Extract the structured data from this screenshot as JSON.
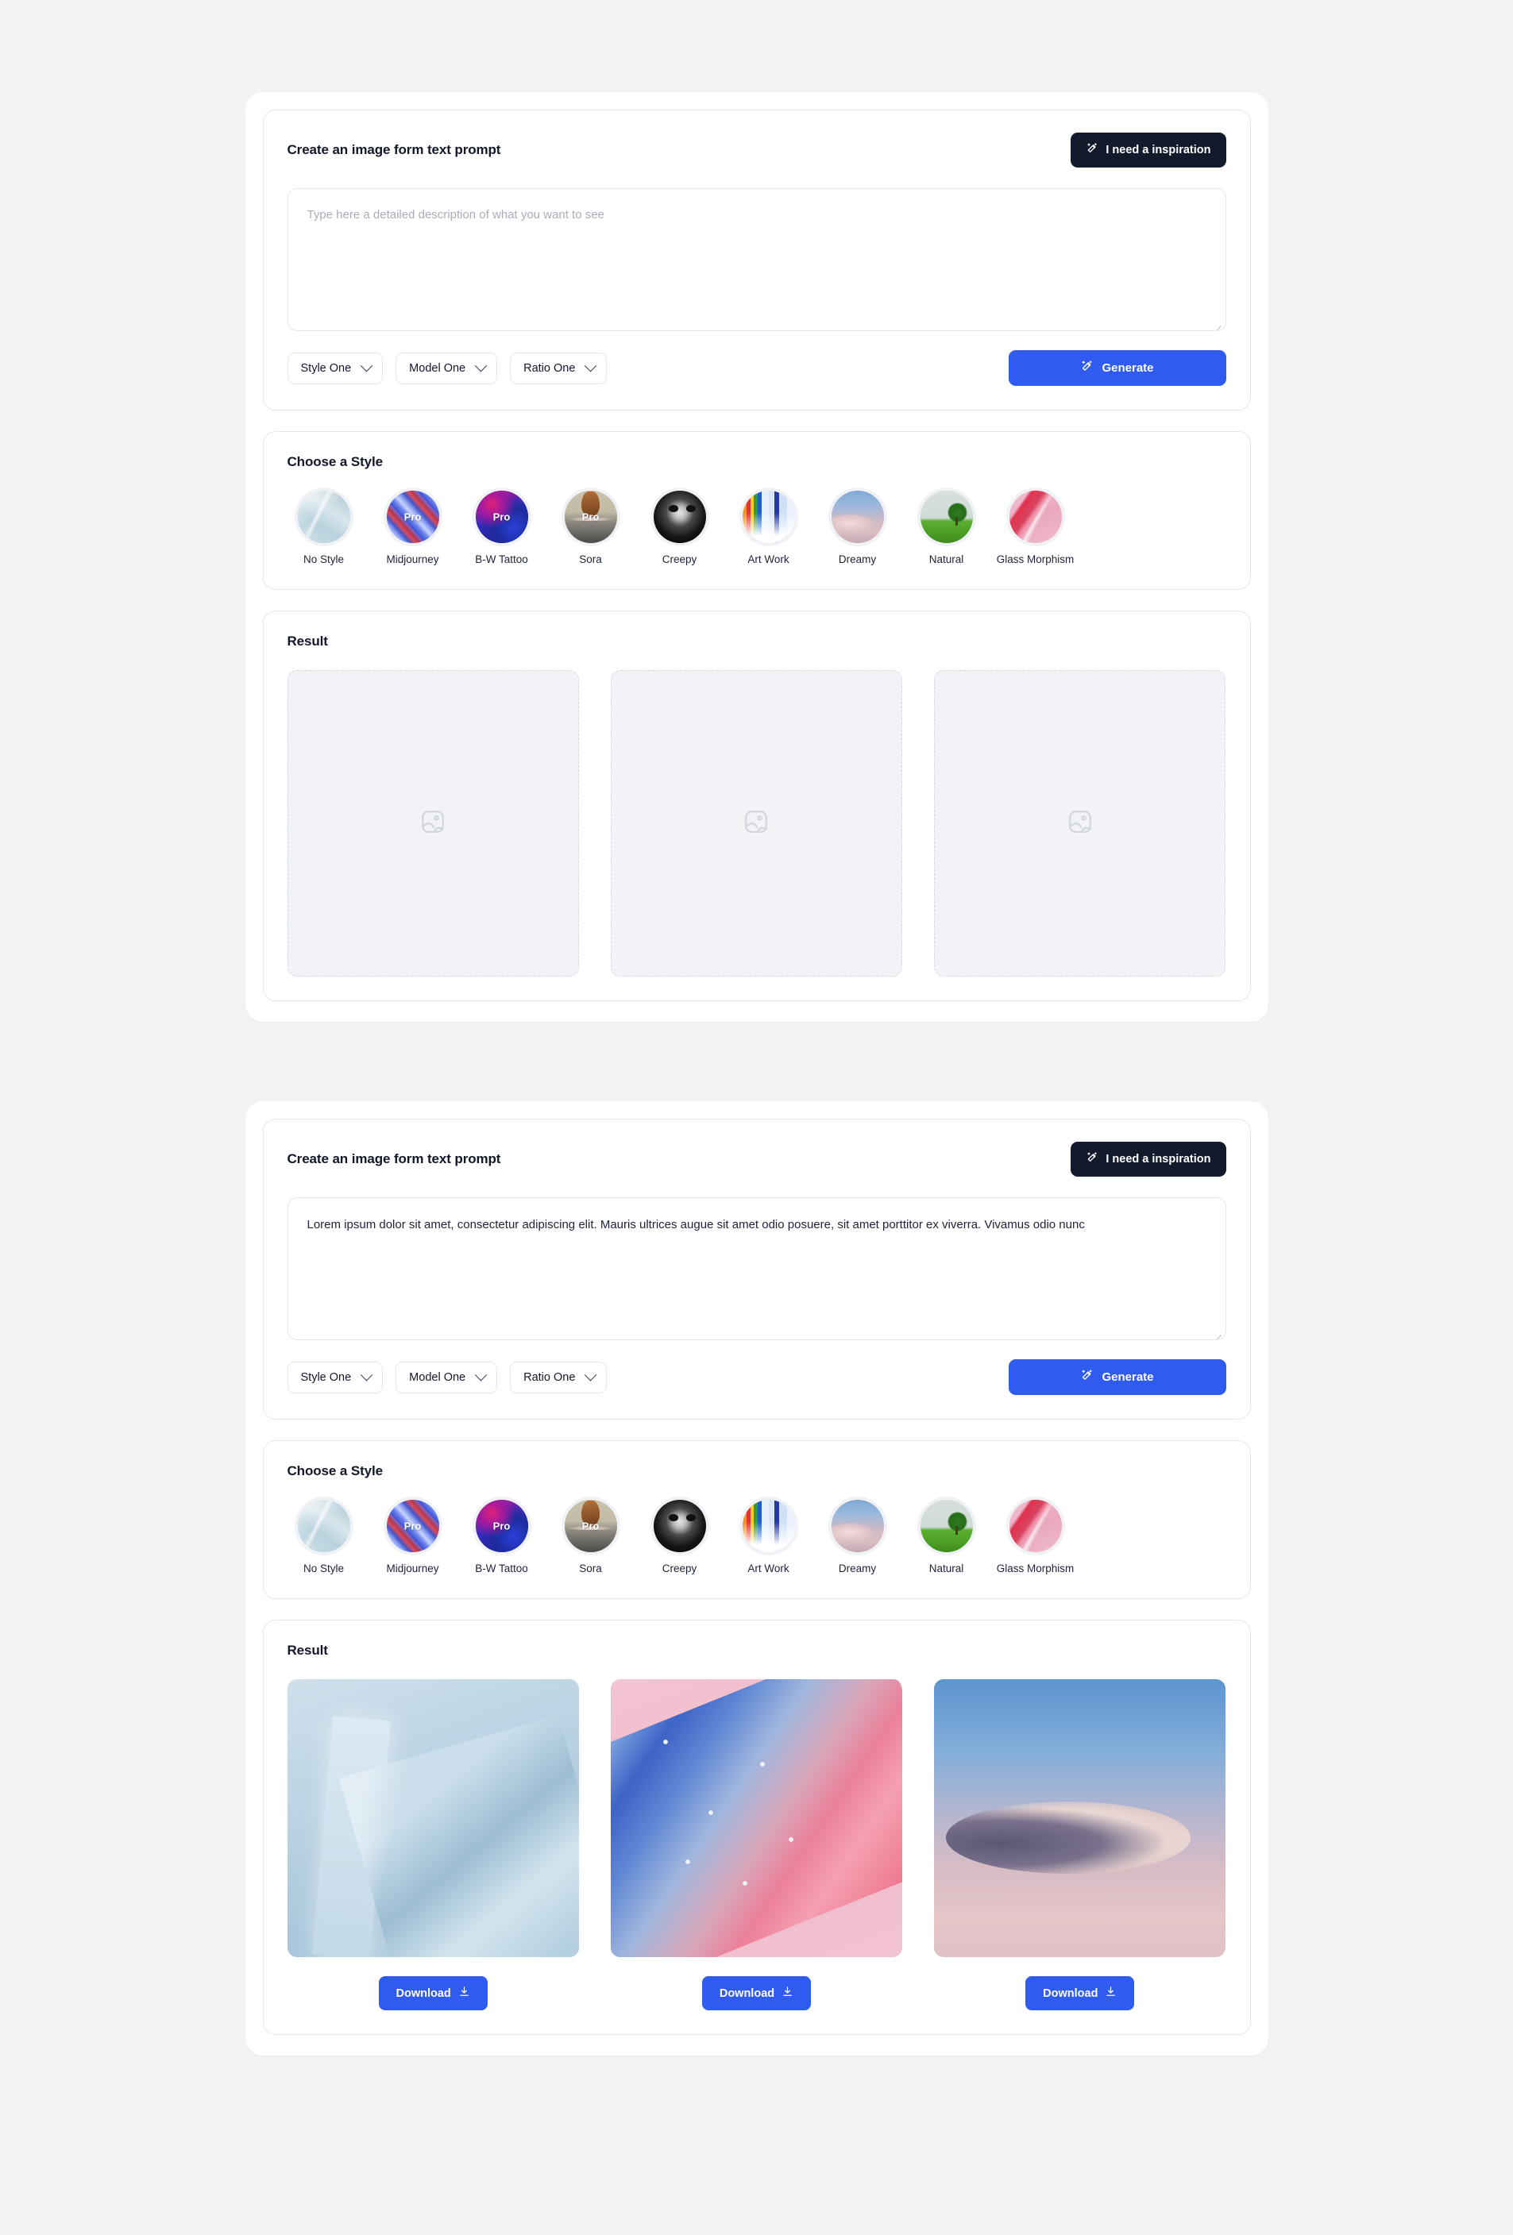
{
  "sections": [
    {
      "id": "empty-state",
      "prompt_card": {
        "title": "Create an image form text prompt",
        "inspiration_label": "I need a inspiration",
        "inspiration_icon": "magic-wand-icon",
        "textarea_placeholder": "Type here a detailed description of what you want to see",
        "textarea_value": "",
        "selects": [
          {
            "label": "Style One",
            "icon": "chevron-down-icon"
          },
          {
            "label": "Model One",
            "icon": "chevron-down-icon"
          },
          {
            "label": "Ratio One",
            "icon": "chevron-down-icon"
          }
        ],
        "generate_label": "Generate",
        "generate_icon": "magic-wand-icon"
      },
      "style_card": {
        "title": "Choose a Style",
        "items": [
          {
            "label": "No Style",
            "art": "art-nostyle",
            "pro": false
          },
          {
            "label": "Midjourney",
            "art": "art-midjourney",
            "pro": true,
            "pro_label": "Pro"
          },
          {
            "label": "B-W Tattoo",
            "art": "art-bwtattoo",
            "pro": true,
            "pro_label": "Pro"
          },
          {
            "label": "Sora",
            "art": "art-sora",
            "pro": true,
            "pro_label": "Pro"
          },
          {
            "label": "Creepy",
            "art": "art-creepy",
            "pro": false
          },
          {
            "label": "Art Work",
            "art": "art-artwork",
            "pro": false
          },
          {
            "label": "Dreamy",
            "art": "art-dreamy",
            "pro": false
          },
          {
            "label": "Natural",
            "art": "art-natural",
            "pro": false
          },
          {
            "label": "Glass Morphism",
            "art": "art-glass",
            "pro": false
          }
        ]
      },
      "result_card": {
        "title": "Result",
        "state": "empty",
        "placeholder_icon": "image-placeholder-icon",
        "slots": [
          {
            "icon": "image-placeholder-icon"
          },
          {
            "icon": "image-placeholder-icon"
          },
          {
            "icon": "image-placeholder-icon"
          }
        ]
      }
    },
    {
      "id": "filled-state",
      "prompt_card": {
        "title": "Create an image form text prompt",
        "inspiration_label": "I need a inspiration",
        "inspiration_icon": "magic-wand-icon",
        "textarea_placeholder": "Type here a detailed description of what you want to see",
        "textarea_value": "Lorem ipsum dolor sit amet, consectetur adipiscing elit. Mauris ultrices augue sit amet odio posuere, sit amet porttitor ex viverra. Vivamus odio nunc",
        "selects": [
          {
            "label": "Style One",
            "icon": "chevron-down-icon"
          },
          {
            "label": "Model One",
            "icon": "chevron-down-icon"
          },
          {
            "label": "Ratio One",
            "icon": "chevron-down-icon"
          }
        ],
        "generate_label": "Generate",
        "generate_icon": "magic-wand-icon"
      },
      "style_card": {
        "title": "Choose a Style",
        "items": [
          {
            "label": "No Style",
            "art": "art-nostyle",
            "pro": false
          },
          {
            "label": "Midjourney",
            "art": "art-midjourney",
            "pro": true,
            "pro_label": "Pro"
          },
          {
            "label": "B-W Tattoo",
            "art": "art-bwtattoo",
            "pro": true,
            "pro_label": "Pro"
          },
          {
            "label": "Sora",
            "art": "art-sora",
            "pro": true,
            "pro_label": "Pro"
          },
          {
            "label": "Creepy",
            "art": "art-creepy",
            "pro": false
          },
          {
            "label": "Art Work",
            "art": "art-artwork",
            "pro": false
          },
          {
            "label": "Dreamy",
            "art": "art-dreamy",
            "pro": false
          },
          {
            "label": "Natural",
            "art": "art-natural",
            "pro": false
          },
          {
            "label": "Glass Morphism",
            "art": "art-glass",
            "pro": false
          }
        ]
      },
      "result_card": {
        "title": "Result",
        "state": "filled",
        "download_label": "Download",
        "download_icon": "download-icon",
        "slots": [
          {
            "art": "img-glass",
            "alt": "abstract pale blue glass panels"
          },
          {
            "art": "img-pink",
            "alt": "pink and blue inflated fabric on pink background"
          },
          {
            "art": "img-sky",
            "alt": "single cloud in blue and pink sky"
          }
        ]
      }
    }
  ],
  "colors": {
    "page_background": "#f2f3f5",
    "panel_background": "#ffffff",
    "card_border": "#e6e8ee",
    "accent_blue": "#2f5bf0",
    "dark_button": "#131a2b",
    "text_primary": "#12172a",
    "placeholder_text": "#a9adbb",
    "empty_slot_background": "#f1f3f6",
    "empty_slot_border": "#d6dae3"
  }
}
